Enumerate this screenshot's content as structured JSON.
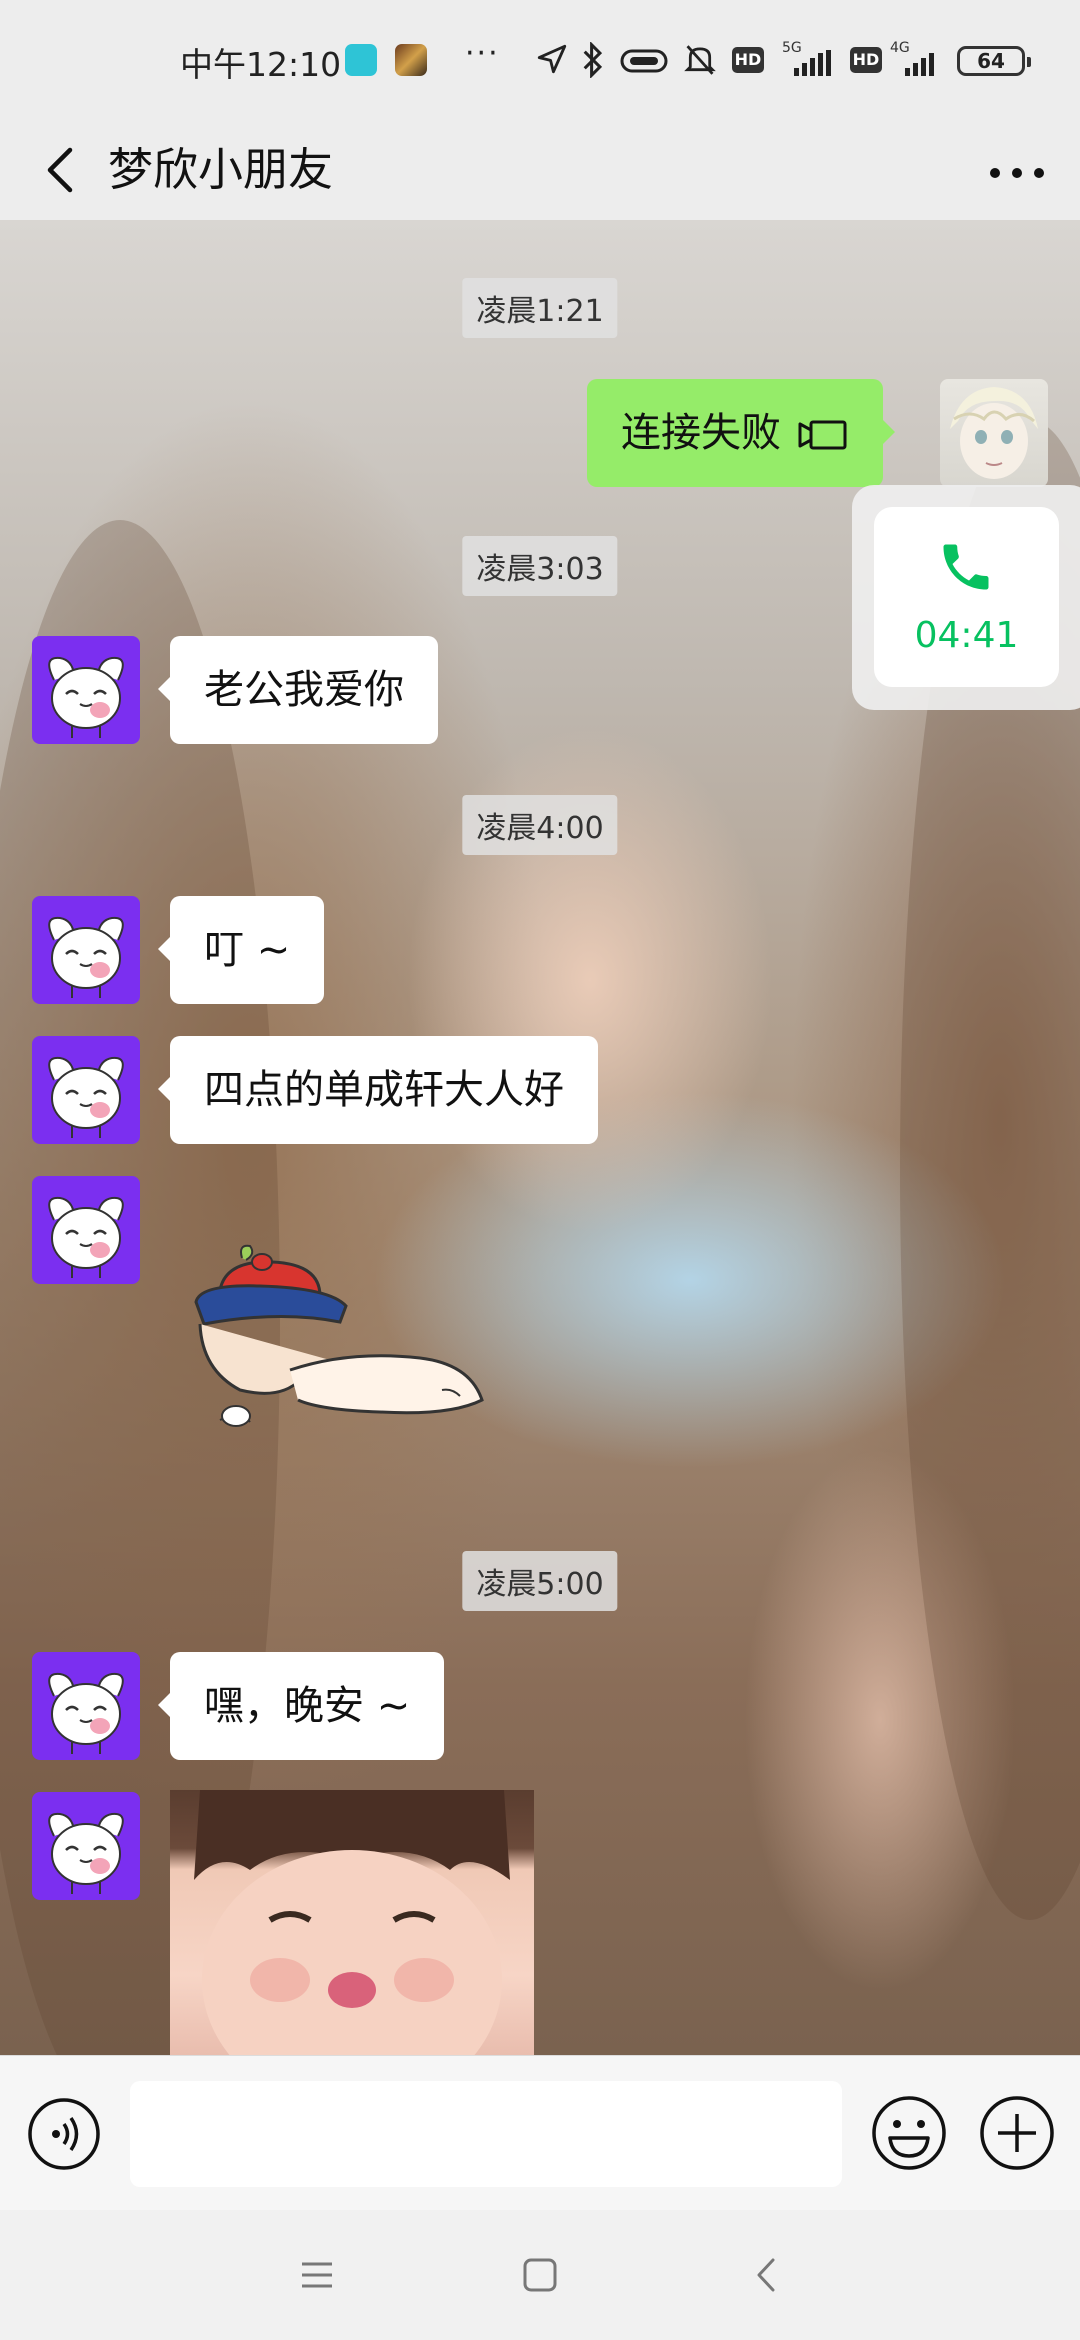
{
  "status_bar": {
    "time": "中午12:10",
    "overflow": "···",
    "hd1": "HD",
    "net1": "5G",
    "hd2": "HD",
    "net2": "4G",
    "battery": "64"
  },
  "header": {
    "title": "梦欣小朋友"
  },
  "messages": {
    "ts1": "凌晨1:21",
    "out1": "连接失败",
    "ts2": "凌晨3:03",
    "in1": "老公我爱你",
    "ts3": "凌晨4:00",
    "in2": "叮 ~",
    "in3": "四点的单成轩大人好",
    "ts4": "凌晨5:00",
    "in4": "嘿，晚安 ~"
  },
  "call_widget": {
    "duration": "04:41"
  },
  "input": {
    "value": "",
    "placeholder": ""
  },
  "colors": {
    "outgoing_bubble": "#95ec69",
    "incoming_bubble": "#ffffff",
    "avatar_bg": "#7b2ff0",
    "call_green": "#07c160",
    "header_bg": "#ededed"
  }
}
